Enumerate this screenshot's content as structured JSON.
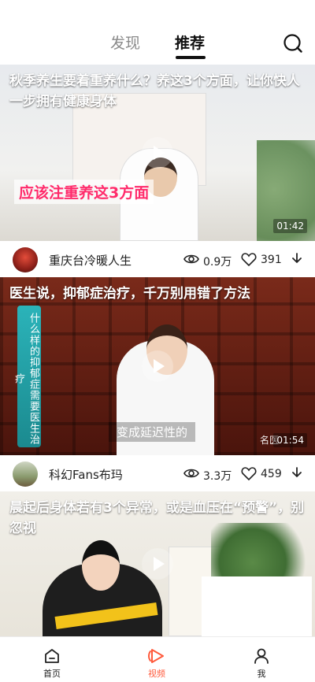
{
  "top_tabs": {
    "discover": "发现",
    "recommend": "推荐",
    "active": "recommend"
  },
  "search": {
    "icon": "search-icon"
  },
  "videos": [
    {
      "title": "秋季养生要着重养什么？养这3个方面，让你快人一步拥有健康身体",
      "overlay_text": "应该注重养这3方面",
      "duration": "01:42",
      "author": "重庆台冷暖人生",
      "views": "0.9万",
      "likes": "391"
    },
    {
      "title": "医生说，抑郁症治疗，千万别用错了方法",
      "overlay_text": "什么样的抑郁症需要医生治疗",
      "caption": "变成延迟性的",
      "brand": "名医",
      "duration": "01:54",
      "author": "科幻Fans布玛",
      "views": "3.3万",
      "likes": "459"
    },
    {
      "title": "晨起后身体若有3个异常，或是血压在“预警”，别忽视"
    }
  ],
  "bottom_nav": {
    "home": "首页",
    "video": "视频",
    "me": "我",
    "active": "video",
    "accent": "#ff5a3c"
  }
}
